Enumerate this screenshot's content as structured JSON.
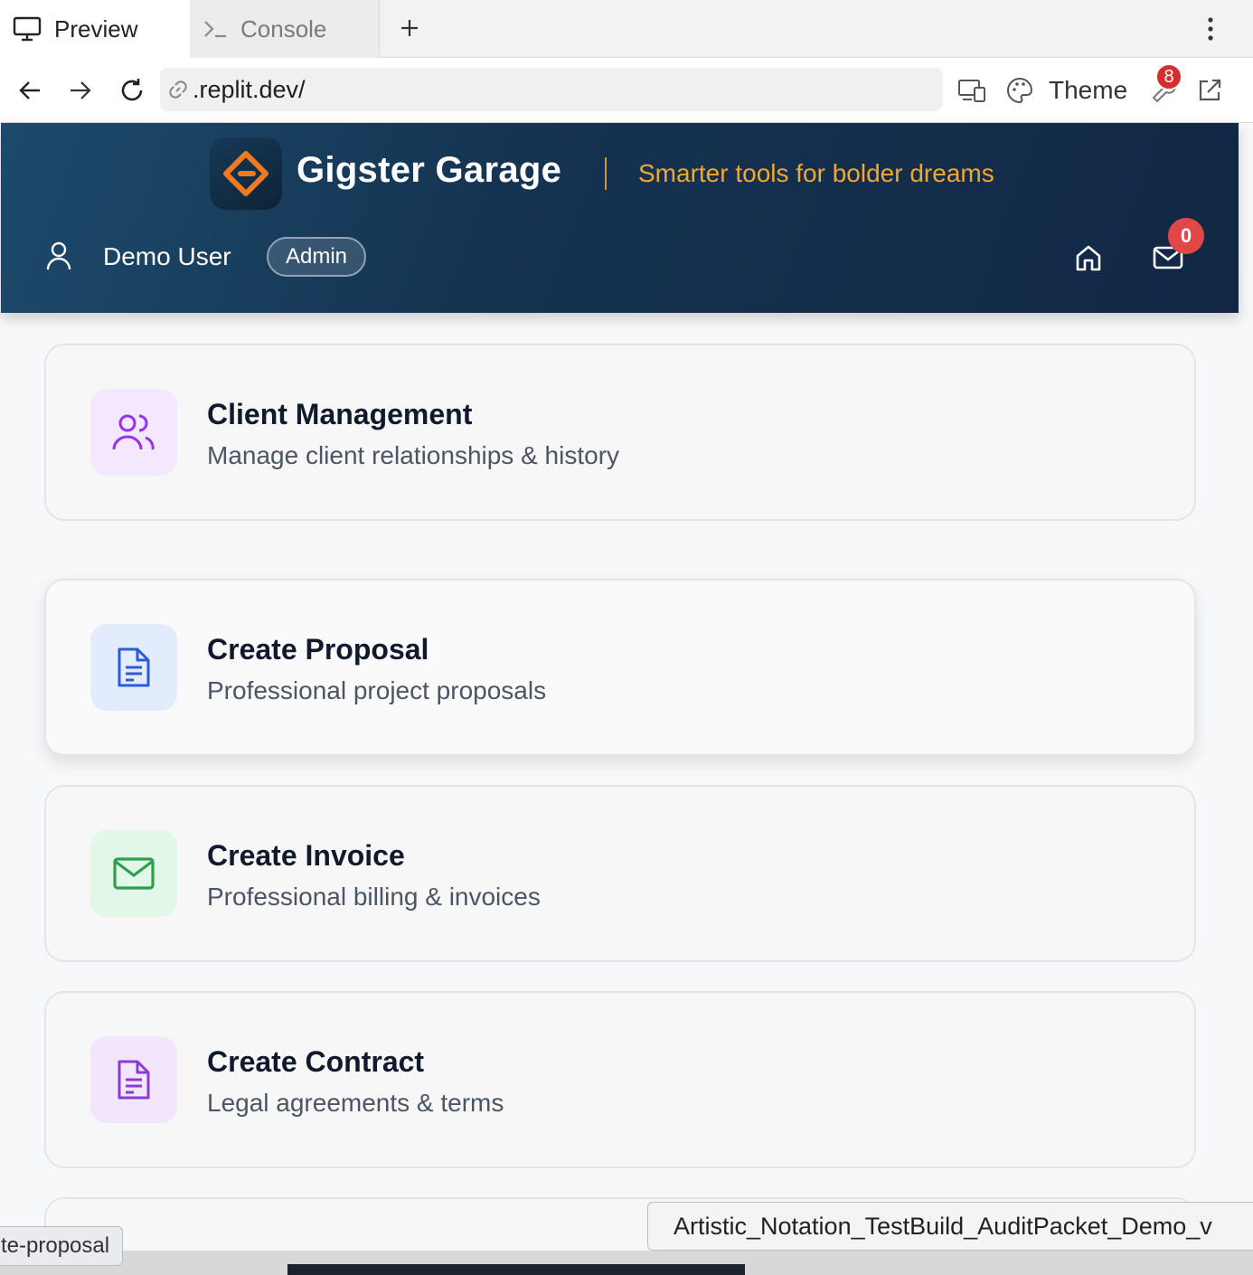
{
  "browser": {
    "tabs": [
      {
        "label": "Preview",
        "icon": "monitor-icon"
      },
      {
        "label": "Console",
        "icon": "terminal-icon"
      }
    ],
    "url": ".replit.dev/",
    "theme_label": "Theme",
    "devtools_badge": "8"
  },
  "header": {
    "brand": "Gigster Garage",
    "tagline": "Smarter tools for bolder dreams",
    "user_name": "Demo User",
    "role": "Admin",
    "mail_count": "0",
    "colors": {
      "accent": "#f0a830",
      "header_bg": "#153452",
      "badge": "#e04848"
    }
  },
  "cards": [
    {
      "title": "Client Management",
      "subtitle": "Manage client relationships & history",
      "icon": "users-icon",
      "icon_color": "#9333ea",
      "icon_bg": "#f3e8fd"
    },
    {
      "title": "Create Proposal",
      "subtitle": "Professional project proposals",
      "icon": "document-icon",
      "icon_color": "#2d5bd7",
      "icon_bg": "#e3ecfc"
    },
    {
      "title": "Create Invoice",
      "subtitle": "Professional billing & invoices",
      "icon": "mail-icon",
      "icon_color": "#2e9e4f",
      "icon_bg": "#e2f7e8"
    },
    {
      "title": "Create Contract",
      "subtitle": "Legal agreements & terms",
      "icon": "document-icon",
      "icon_color": "#8a3bd6",
      "icon_bg": "#f1e6fc"
    }
  ],
  "overlays": {
    "status_link": "te-proposal",
    "file_tooltip": "Artistic_Notation_TestBuild_AuditPacket_Demo_v"
  }
}
